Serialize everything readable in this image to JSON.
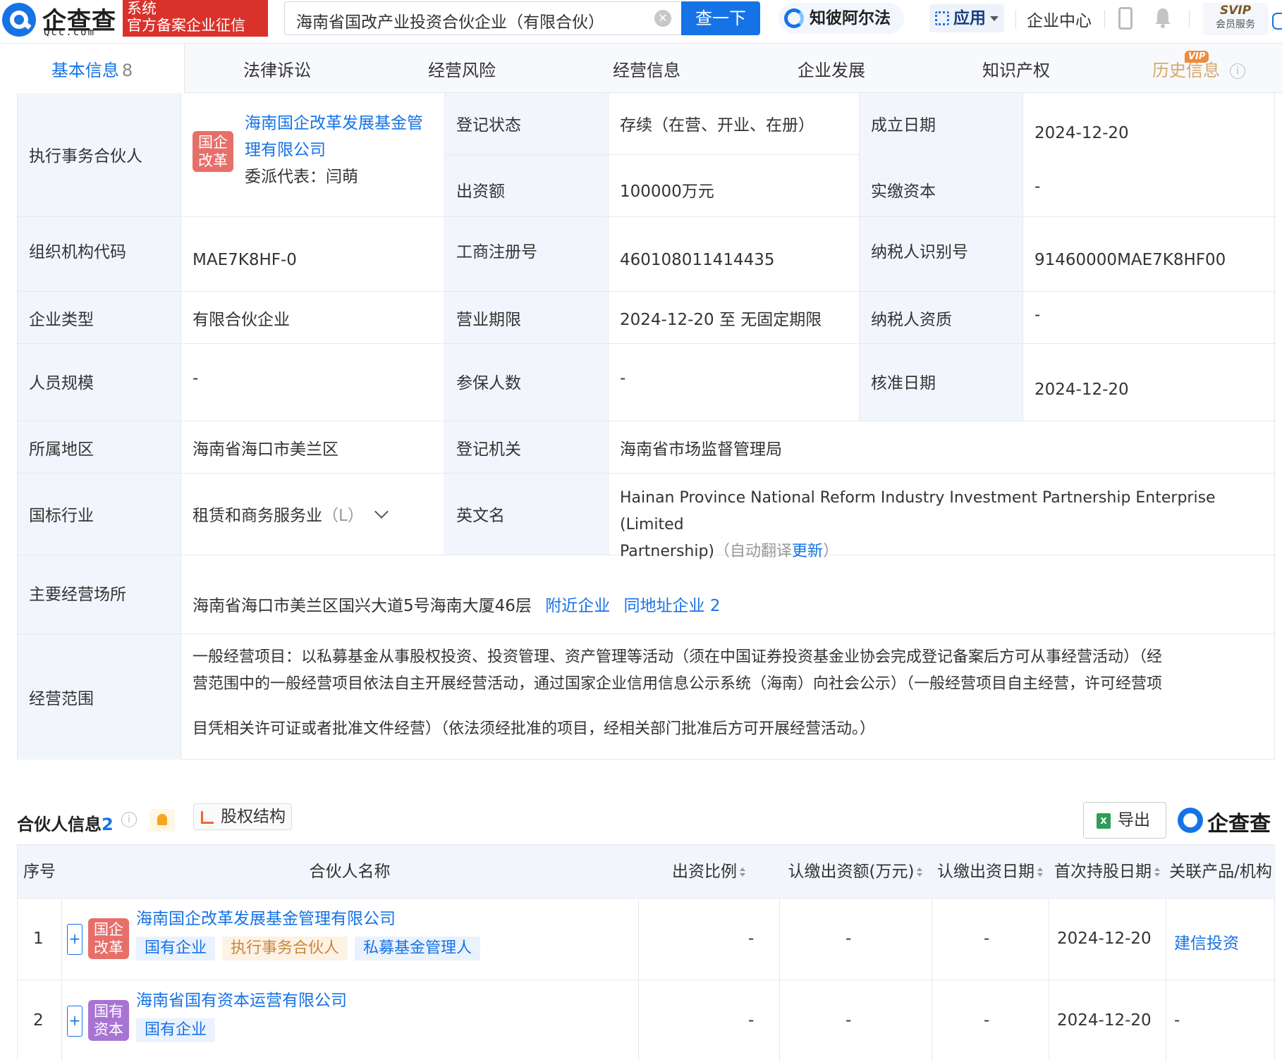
{
  "header": {
    "logo_text": "企查查",
    "logo_sub": "Qcc.com",
    "badge_line1": "系统",
    "badge_line2": "官方备案企业征信",
    "search_value": "海南省国改产业投资合伙企业（有限合伙）",
    "search_button": "查一下",
    "ai_label": "知彼阿尔法",
    "app_label": "应用",
    "enterprise_center": "企业中心",
    "svip_line1": "SVIP",
    "svip_line2": "会员服务"
  },
  "tabs": [
    {
      "label": "基本信息",
      "count": "8"
    },
    {
      "label": "法律诉讼"
    },
    {
      "label": "经营风险"
    },
    {
      "label": "经营信息"
    },
    {
      "label": "企业发展"
    },
    {
      "label": "知识产权"
    },
    {
      "label": "历史信息",
      "badge": "VIP"
    }
  ],
  "basic": {
    "exec_partner_label": "执行事务合伙人",
    "exec_partner_logo": [
      "国企",
      "改革"
    ],
    "exec_partner_name_line1": "海南国企改革发展基金管",
    "exec_partner_name_line2": "理有限公司",
    "exec_partner_rep": "委派代表：闫萌",
    "reg_status_label": "登记状态",
    "reg_status": "存续（在营、开业、在册）",
    "est_date_label": "成立日期",
    "est_date": "2024-12-20",
    "capital_label": "出资额",
    "capital": "100000万元",
    "paid_label": "实缴资本",
    "paid": "-",
    "org_code_label": "组织机构代码",
    "org_code": "MAE7K8HF-0",
    "biz_reg_label": "工商注册号",
    "biz_reg": "460108011414435",
    "tax_id_label": "纳税人识别号",
    "tax_id": "91460000MAE7K8HF00",
    "type_label": "企业类型",
    "type": "有限合伙企业",
    "term_label": "营业期限",
    "term": "2024-12-20 至 无固定期限",
    "tax_qual_label": "纳税人资质",
    "tax_qual": "-",
    "staff_label": "人员规模",
    "staff": "-",
    "insured_label": "参保人数",
    "insured": "-",
    "approve_label": "核准日期",
    "approve": "2024-12-20",
    "region_label": "所属地区",
    "region": "海南省海口市美兰区",
    "authority_label": "登记机关",
    "authority": "海南省市场监督管理局",
    "industry_label": "国标行业",
    "industry": "租赁和商务服务业",
    "industry_code": "（L）",
    "en_name_label": "英文名",
    "en_name_line1": "Hainan Province National Reform Industry Investment Partnership Enterprise (Limited",
    "en_name_line2": "Partnership)",
    "en_auto": "（自动翻译",
    "en_update": "更新",
    "en_close": "）",
    "address_label": "主要经营场所",
    "address": "海南省海口市美兰区国兴大道5号海南大厦46层",
    "nearby": "附近企业",
    "same_addr": "同地址企业 2",
    "scope_label": "经营范围",
    "scope_line1": "一般经营项目：以私募基金从事股权投资、投资管理、资产管理等活动（须在中国证券投资基金业协会完成登记备案后方可从事经营活动）（经",
    "scope_line2": "营范围中的一般经营项目依法自主开展经营活动，通过国家企业信用信息公示系统（海南）向社会公示）（一般经营项目自主经营，许可经营项",
    "scope_line3": "目凭相关许可证或者批准文件经营）（依法须经批准的项目，经相关部门批准后方可开展经营活动。）"
  },
  "partners": {
    "title": "合伙人信息",
    "count": "2",
    "equity_button": "股权结构",
    "export_button": "导出",
    "brand": "企查查",
    "columns": [
      "序号",
      "合伙人名称",
      "出资比例",
      "认缴出资额(万元)",
      "认缴出资日期",
      "首次持股日期",
      "关联产品/机构"
    ],
    "rows": [
      {
        "index": "1",
        "logo": [
          "国企",
          "改革"
        ],
        "name": "海南国企改革发展基金管理有限公司",
        "tags": [
          "国有企业",
          "执行事务合伙人",
          "私募基金管理人"
        ],
        "ratio": "-",
        "subscribed": "-",
        "sub_date": "-",
        "first_date": "2024-12-20",
        "related": "建信投资"
      },
      {
        "index": "2",
        "logo": [
          "国有",
          "资本"
        ],
        "name": "海南省国有资本运营有限公司",
        "tags": [
          "国有企业"
        ],
        "ratio": "-",
        "subscribed": "-",
        "sub_date": "-",
        "first_date": "2024-12-20",
        "related": "-"
      }
    ]
  }
}
